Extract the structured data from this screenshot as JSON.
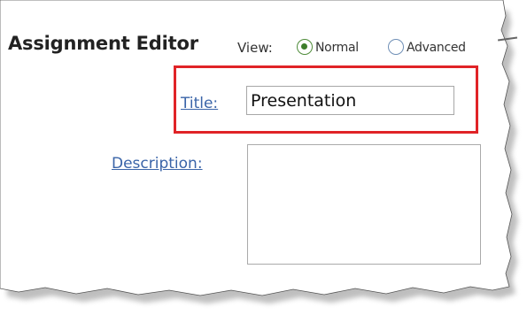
{
  "editor": {
    "title": "Assignment Editor",
    "view_label": "View:",
    "view_options": [
      {
        "label": "Normal",
        "selected": true
      },
      {
        "label": "Advanced",
        "selected": false
      }
    ]
  },
  "form": {
    "title_label": "Title:",
    "title_value": "Presentation",
    "description_label": "Description:",
    "description_value": ""
  },
  "colors": {
    "highlight": "#e02327",
    "link": "#3a64a8",
    "radio_selected": "#3d7d2a"
  },
  "icons": [
    "radio-selected-icon",
    "radio-unselected-icon"
  ]
}
